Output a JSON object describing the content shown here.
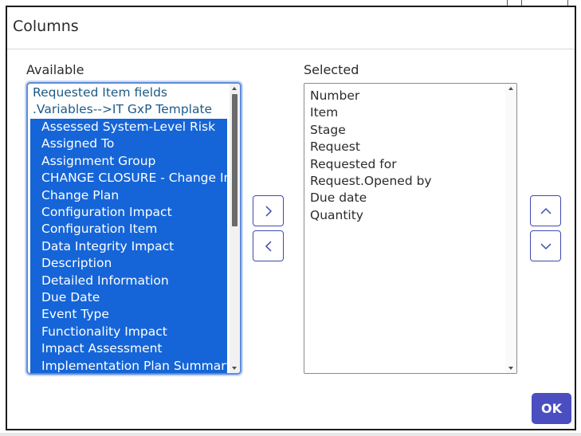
{
  "dialog": {
    "title": "Columns",
    "ok_label": "OK"
  },
  "available": {
    "label": "Available",
    "groups": [
      "Requested Item fields",
      ".Variables-->IT GxP Template"
    ],
    "items": [
      "Assessed System-Level Risk",
      "Assigned To",
      "Assignment Group",
      "CHANGE CLOSURE - Change Implementation",
      "Change Plan",
      "Configuration Impact",
      "Configuration Item",
      "Data Integrity Impact",
      "Description",
      "Detailed Information",
      "Due Date",
      "Event Type",
      "Functionality Impact",
      "Impact Assessment",
      "Implementation Plan Summary"
    ]
  },
  "selected": {
    "label": "Selected",
    "items": [
      "Number",
      "Item",
      "Stage",
      "Request",
      "Requested for",
      "Request.Opened by",
      "Due date",
      "Quantity"
    ]
  },
  "icons": {
    "add": "chevron-right-icon",
    "remove": "chevron-left-icon",
    "move_up": "chevron-up-icon",
    "move_down": "chevron-down-icon"
  },
  "colors": {
    "selection": "#1565d8",
    "group_text": "#1b5a86",
    "button_border": "#3f4ab0",
    "ok_button": "#4a4ec0"
  }
}
